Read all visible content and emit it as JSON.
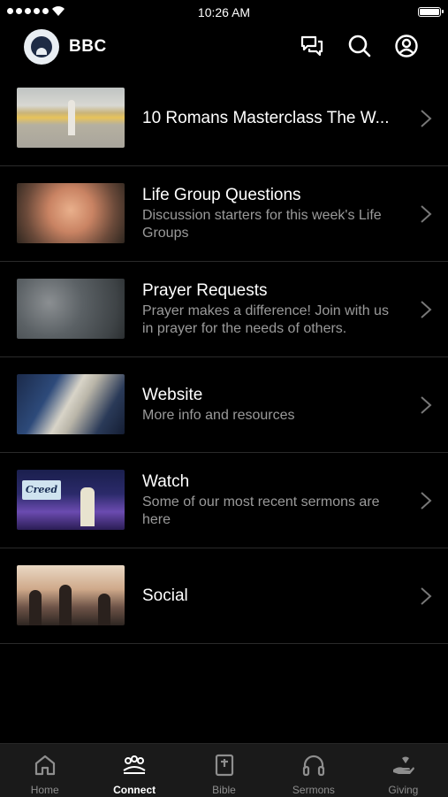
{
  "status_bar": {
    "time": "10:26 AM"
  },
  "header": {
    "title": "BBC",
    "icons": [
      "chat-icon",
      "search-icon",
      "profile-icon"
    ]
  },
  "items": [
    {
      "title": "10 Romans Masterclass The W...",
      "subtitle": ""
    },
    {
      "title": "Life Group Questions",
      "subtitle": "Discussion starters for this week's Life Groups"
    },
    {
      "title": "Prayer Requests",
      "subtitle": "Prayer makes a difference! Join with us in prayer for the needs of others."
    },
    {
      "title": "Website",
      "subtitle": "More info and resources"
    },
    {
      "title": "Watch",
      "subtitle": "Some of our most recent sermons are here"
    },
    {
      "title": "Social",
      "subtitle": ""
    }
  ],
  "tabs": [
    {
      "label": "Home",
      "icon": "home-icon"
    },
    {
      "label": "Connect",
      "icon": "people-icon",
      "active": true
    },
    {
      "label": "Bible",
      "icon": "bible-icon"
    },
    {
      "label": "Sermons",
      "icon": "headphones-icon"
    },
    {
      "label": "Giving",
      "icon": "giving-icon"
    }
  ],
  "colors": {
    "background": "#000000",
    "tabbar": "#1a1a1a",
    "secondary_text": "#9a9a9a"
  }
}
